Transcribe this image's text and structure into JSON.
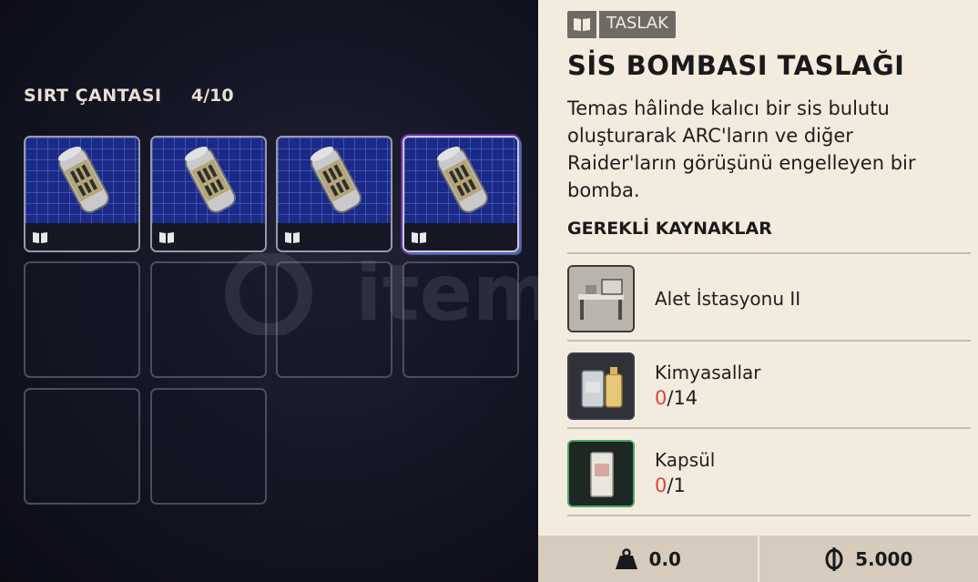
{
  "backpack": {
    "title": "SIRT ÇANTASI",
    "count": "4/10"
  },
  "watermark": "itemsatış",
  "item": {
    "tag": "TASLAK",
    "title": "SİS BOMBASI TASLAĞI",
    "description": "Temas hâlinde kalıcı bir sis bulutu oluşturarak ARC'ların ve diğer Raider'ların görüşünü engelleyen bir bomba."
  },
  "requirements": {
    "title": "GEREKLİ KAYNAKLAR",
    "items": [
      {
        "name": "Alet İstasyonu II",
        "icon": "workbench-icon"
      },
      {
        "name": "Kimyasallar",
        "have": "0",
        "need": "/14",
        "icon": "chemicals-icon"
      },
      {
        "name": "Kapsül",
        "have": "0",
        "need": "/1",
        "icon": "capsule-icon"
      }
    ]
  },
  "stats": {
    "weight": "0.0",
    "price": "5.000"
  },
  "colors": {
    "missing": "#d9463d",
    "thumb_bg": "#1b2a86",
    "panel_bg": "#f4ebdf"
  }
}
